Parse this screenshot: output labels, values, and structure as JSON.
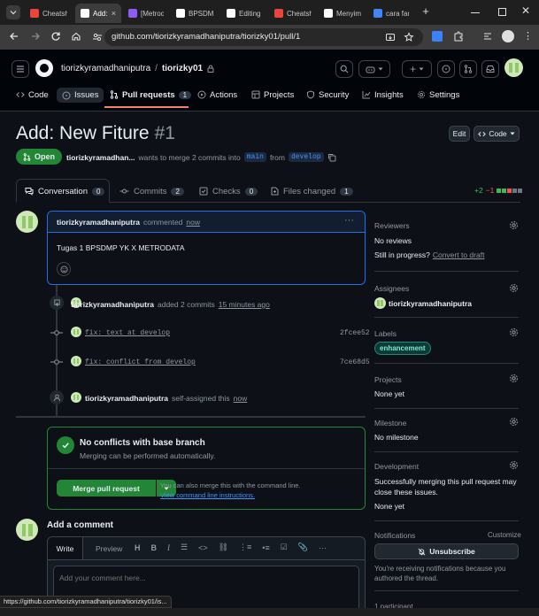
{
  "browser": {
    "tabs": [
      {
        "label": "Cheatsh",
        "color": "#e8453c",
        "active": false
      },
      {
        "label": "Add:",
        "color": "#ffffff",
        "active": true
      },
      {
        "label": "[Metroc",
        "color": "#8b5cf6",
        "active": false
      },
      {
        "label": "BPSDM",
        "color": "#ffffff",
        "active": false
      },
      {
        "label": "Editing",
        "color": "#ffffff",
        "active": false
      },
      {
        "label": "Cheatsh",
        "color": "#e8453c",
        "active": false
      },
      {
        "label": "Menyim",
        "color": "#ffffff",
        "active": false
      },
      {
        "label": "cara fan",
        "color": "#4285f4",
        "active": false
      }
    ],
    "url": "github.com/tiorizkyramadhaniputra/tiorizky01/pull/1",
    "status_url": "https://github.com/tiorizkyramadhaniputra/tiorizky01/is..."
  },
  "header": {
    "owner": "tiorizkyramadhaniputra",
    "separator": "/",
    "repo": "tiorizky01"
  },
  "nav": {
    "code": "Code",
    "issues": "Issues",
    "pulls": "Pull requests",
    "pulls_count": "1",
    "actions": "Actions",
    "projects": "Projects",
    "security": "Security",
    "insights": "Insights",
    "settings": "Settings"
  },
  "pr": {
    "title": "Add: New Fiture",
    "number": "#1",
    "edit": "Edit",
    "code": "Code",
    "state": "Open",
    "author": "tiorizkyramadhan...",
    "merge_text": "wants to merge 2 commits into",
    "base": "main",
    "from": "from",
    "head": "develop",
    "tabs": {
      "conversation": "Conversation",
      "conversation_count": "0",
      "commits": "Commits",
      "commits_count": "2",
      "checks": "Checks",
      "checks_count": "0",
      "files": "Files changed",
      "files_count": "1"
    },
    "diff_add": "+2",
    "diff_del": "−1"
  },
  "comment": {
    "author": "tiorizkyramadhaniputra",
    "action": "commented",
    "time": "now",
    "menu": "···",
    "body": "Tugas 1 BPSDMP YK X METRODATA"
  },
  "timeline": {
    "commits_event_author": "tiorizkyramadhaniputra",
    "commits_event_text": "added 2 commits",
    "commits_event_time": "15 minutes ago",
    "commits": [
      {
        "message": "fix: text at develop",
        "sha": "2fcee52"
      },
      {
        "message": "fix: conflict from develop",
        "sha": "7ce68d5"
      }
    ],
    "assign_author": "tiorizkyramadhaniputra",
    "assign_text": "self-assigned this",
    "assign_time": "now"
  },
  "merge": {
    "title": "No conflicts with base branch",
    "subtitle": "Merging can be performed automatically.",
    "button": "Merge pull request",
    "hint": "You can also merge this with the command line.",
    "hint_link": "View command line instructions."
  },
  "add_comment": {
    "title": "Add a comment",
    "write": "Write",
    "preview": "Preview",
    "placeholder": "Add your comment here..."
  },
  "sidebar": {
    "reviewers_h": "Reviewers",
    "reviewers_v": "No reviews",
    "in_progress": "Still in progress?",
    "draft_link": "Convert to draft",
    "assignees_h": "Assignees",
    "assignee": "tiorizkyramadhaniputra",
    "labels_h": "Labels",
    "label": "enhancement",
    "projects_h": "Projects",
    "projects_v": "None yet",
    "milestone_h": "Milestone",
    "milestone_v": "No milestone",
    "development_h": "Development",
    "development_v": "Successfully merging this pull request may close these issues.",
    "development_none": "None yet",
    "notifications_h": "Notifications",
    "customize": "Customize",
    "unsubscribe": "Unsubscribe",
    "notif_reason": "You're receiving notifications because you authored the thread.",
    "participants": "1 participant"
  }
}
